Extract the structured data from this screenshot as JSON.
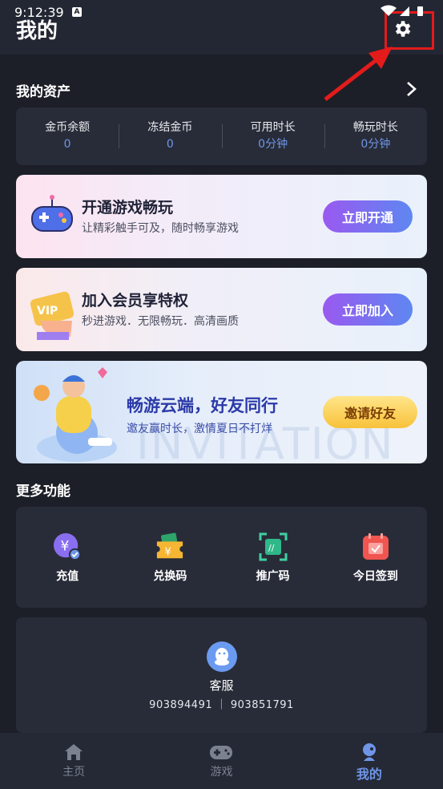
{
  "status": {
    "time": "9:12:39",
    "indicator": "A"
  },
  "header": {
    "title": "我的"
  },
  "assets": {
    "title": "我的资产",
    "items": [
      {
        "label": "金币余额",
        "value": "0"
      },
      {
        "label": "冻结金币",
        "value": "0"
      },
      {
        "label": "可用时长",
        "value": "0分钟"
      },
      {
        "label": "畅玩时长",
        "value": "0分钟"
      }
    ]
  },
  "banners": [
    {
      "title": "开通游戏畅玩",
      "subtitle": "让精彩触手可及，随时畅享游戏",
      "button": "立即开通"
    },
    {
      "title": "加入会员享特权",
      "subtitle": "秒进游戏．无限畅玩．高清画质",
      "button": "立即加入",
      "badge": "VIP"
    },
    {
      "title": "畅游云端，好友同行",
      "subtitle": "邀友赢时长，激情夏日不打烊",
      "button": "邀请好友",
      "watermark": "INVITATION"
    }
  ],
  "more": {
    "title": "更多功能",
    "items": [
      {
        "label": "充值",
        "icon": "recharge-icon"
      },
      {
        "label": "兑换码",
        "icon": "ticket-icon"
      },
      {
        "label": "推广码",
        "icon": "scan-code-icon"
      },
      {
        "label": "今日签到",
        "icon": "calendar-checkin-icon"
      }
    ]
  },
  "service": {
    "label": "客服",
    "numbers": "903894491 ｜ 903851791"
  },
  "tabs": [
    {
      "label": "主页",
      "icon": "home-icon",
      "active": false
    },
    {
      "label": "游戏",
      "icon": "gamepad-icon",
      "active": false
    },
    {
      "label": "我的",
      "icon": "profile-icon",
      "active": true
    }
  ],
  "colors": {
    "accent": "#6f95e8",
    "highlight": "#e31b1b",
    "background": "#1c1f28"
  }
}
